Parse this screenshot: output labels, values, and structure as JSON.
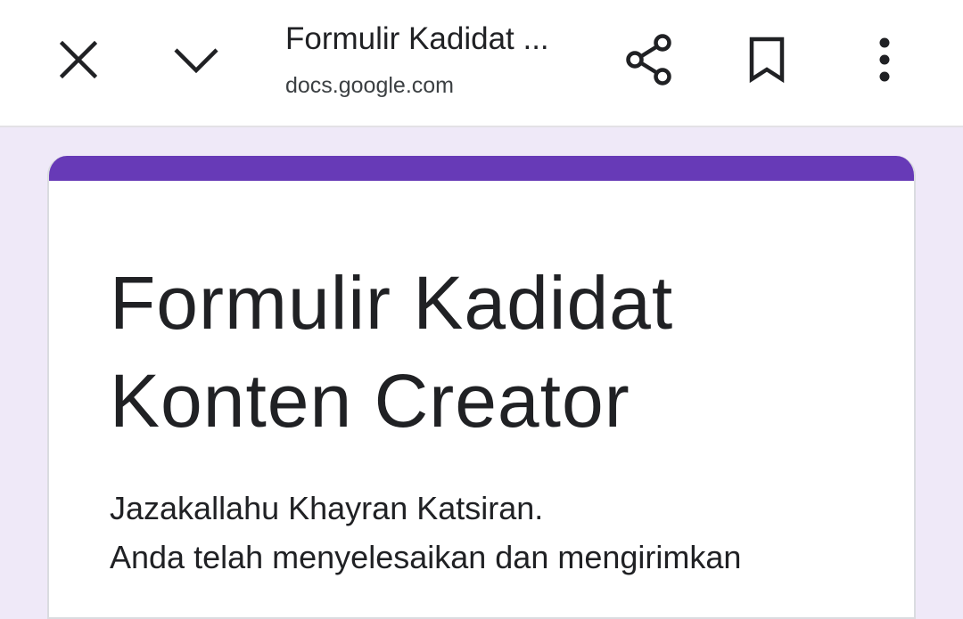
{
  "toolbar": {
    "title": "Formulir Kadidat ...",
    "url": "docs.google.com",
    "icons": {
      "close": "close-icon",
      "minimize": "chevron-down-icon",
      "share": "share-icon",
      "bookmark": "bookmark-icon",
      "more": "more-vert-icon"
    }
  },
  "form": {
    "title_line1": "Formulir Kadidat",
    "title_line2": "Konten Creator",
    "message_line1": "Jazakallahu Khayran Katsiran.",
    "message_line2": "Anda telah menyelesaikan dan mengirimkan"
  },
  "colors": {
    "accent": "#673ab7",
    "background": "#efe9f8",
    "text": "#202124"
  }
}
